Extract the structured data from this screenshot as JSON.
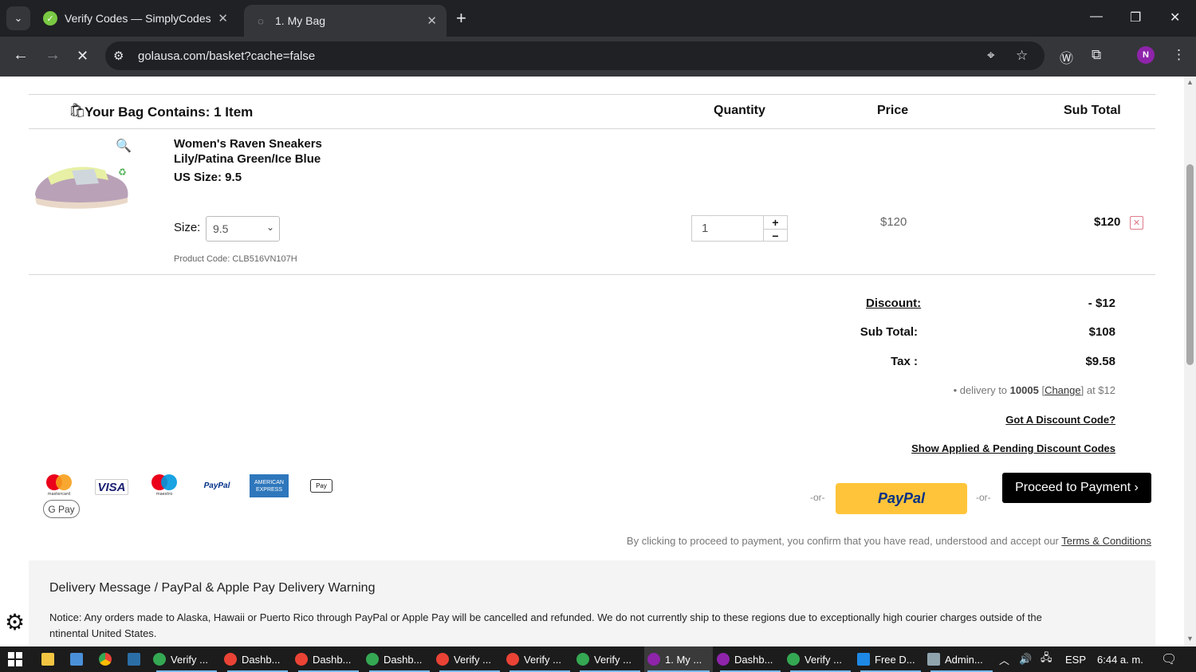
{
  "browser": {
    "tabs": [
      {
        "title": "Verify Codes — SimplyCodes",
        "active": false
      },
      {
        "title": "1. My Bag",
        "active": true
      }
    ],
    "url": "golausa.com/basket?cache=false",
    "profile_initial": "N"
  },
  "bag": {
    "heading": "Your Bag Contains: 1 Item",
    "col_quantity": "Quantity",
    "col_price": "Price",
    "col_subtotal": "Sub Total"
  },
  "item": {
    "name_line1": "Women's Raven Sneakers",
    "name_line2": "Lily/Patina Green/Ice Blue",
    "us_size": "US Size: 9.5",
    "size_label": "Size:",
    "size_value": "9.5",
    "product_code": "Product Code: CLB516VN107H",
    "quantity": "1",
    "price": "$120",
    "subtotal": "$120"
  },
  "summary": {
    "discount_label": "Discount:",
    "discount_value": "- $12",
    "subtotal_label": "Sub Total:",
    "subtotal_value": "$108",
    "tax_label": "Tax :",
    "tax_value": "$9.58",
    "delivery_prefix": "• delivery to",
    "delivery_zip": "10005",
    "delivery_change": "Change",
    "delivery_suffix": "at $12",
    "got_discount": "Got A Discount Code?",
    "show_applied": "Show Applied & Pending Discount Codes"
  },
  "payment": {
    "or1": "-or-",
    "or2": "-or-",
    "paypal_label": "PayPal",
    "proceed_label": "Proceed to Payment ›",
    "terms_prefix": "By clicking to proceed to payment, you confirm that you have read, understood and accept our",
    "terms_link": "Terms & Conditions",
    "logos": {
      "mastercard": "mastercard",
      "visa": "VISA",
      "maestro": "maestro",
      "paypal": "PayPal",
      "amex1": "AMERICAN",
      "amex2": "EXPRESS",
      "applepay": "Pay",
      "gpay": "G Pay"
    }
  },
  "delivery_notice": {
    "title": "Delivery Message / PayPal & Apple Pay Delivery Warning",
    "text_line1": "Notice: Any orders made to Alaska, Hawaii or Puerto Rico through PayPal or Apple Pay will be cancelled and refunded. We do not currently ship to these regions due to exceptionally high courier charges outside of the",
    "text_line2": "ntinental United States."
  },
  "taskbar": {
    "items": [
      "Verify ...",
      "Dashb...",
      "Dashb...",
      "Dashb...",
      "Verify ...",
      "Verify ...",
      "Verify ...",
      "1. My ...",
      "Dashb...",
      "Verify ...",
      "Free D...",
      "Admin..."
    ],
    "lang": "ESP",
    "time": "6:44 a. m."
  }
}
